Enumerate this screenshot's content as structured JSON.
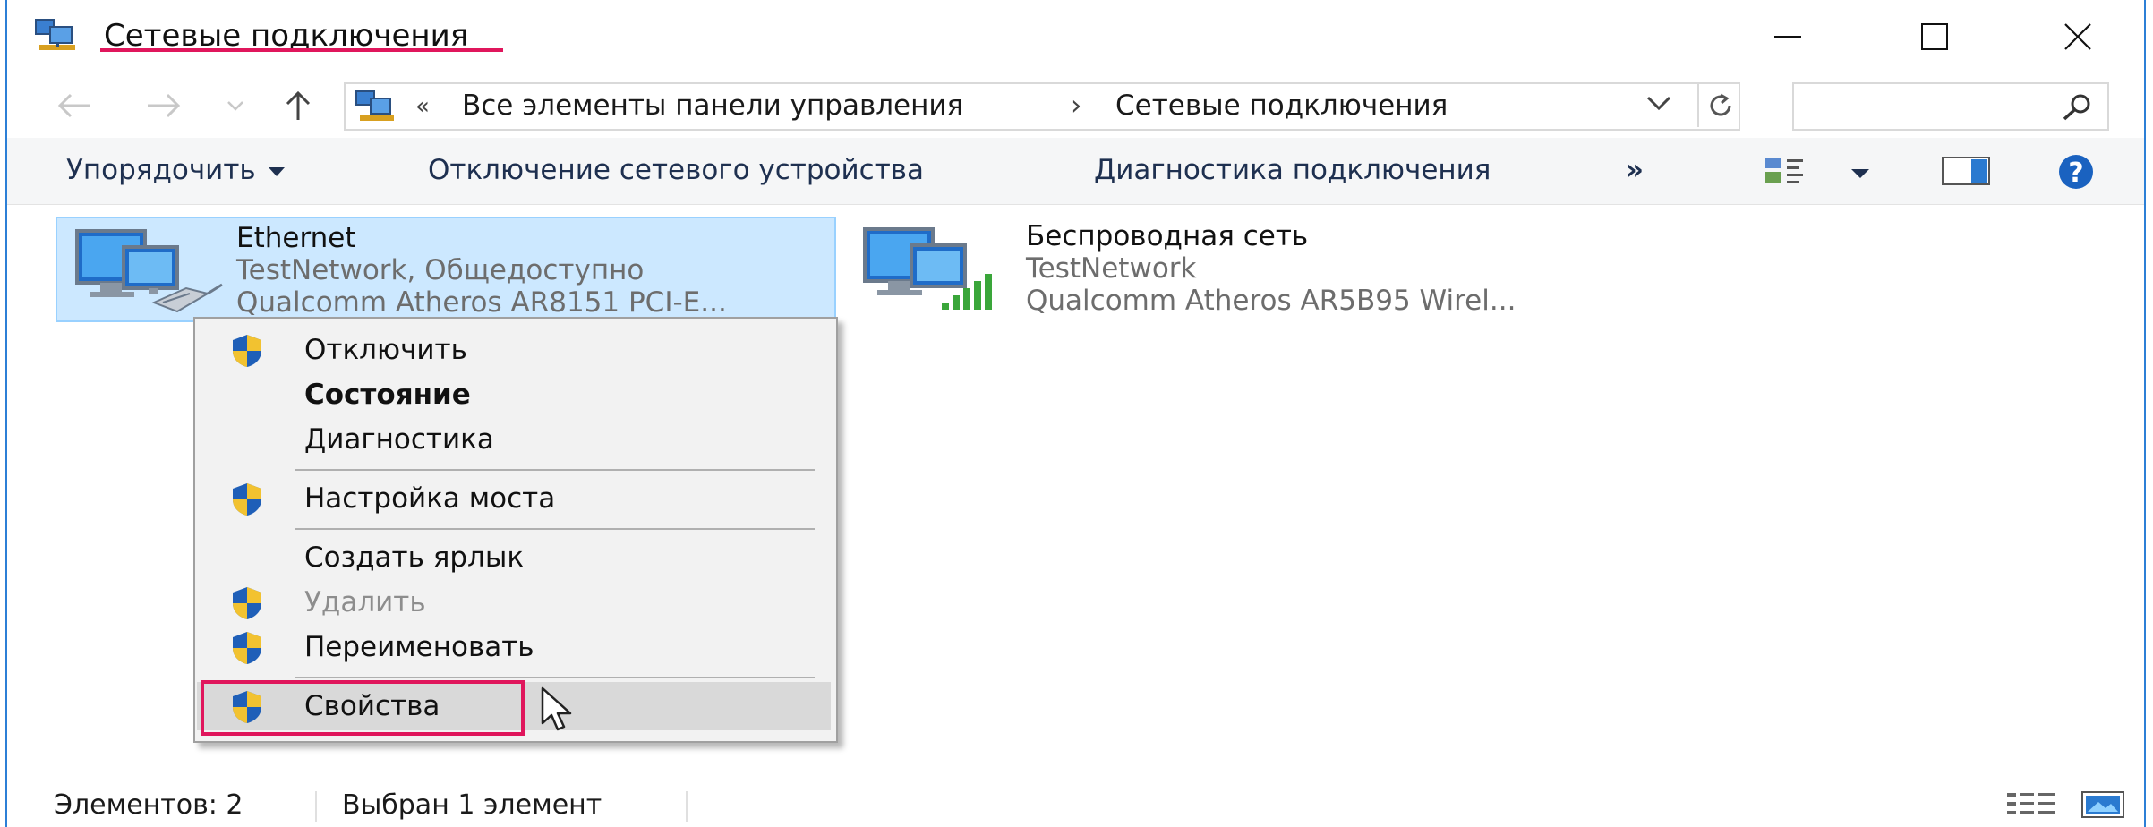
{
  "window": {
    "title": "Сетевые подключения",
    "accent_color": "#2c7fd6",
    "highlight_color": "#e0165c"
  },
  "titlebar_buttons": {
    "minimize_icon": "minimize-icon",
    "maximize_icon": "maximize-icon",
    "close_icon": "close-icon"
  },
  "address": {
    "prefix": "«",
    "crumb_1": "Все элементы панели управления",
    "separator": "›",
    "crumb_2": "Сетевые подключения"
  },
  "search": {
    "placeholder": ""
  },
  "toolbar": {
    "organize": "Упорядочить",
    "disable_device": "Отключение сетевого устройства",
    "diagnose": "Диагностика подключения",
    "more": "»"
  },
  "items": [
    {
      "name": "Ethernet",
      "status": "TestNetwork, Общедоступно",
      "adapter": "Qualcomm Atheros AR8151 PCI-E..."
    },
    {
      "name": "Беспроводная сеть",
      "status": "TestNetwork",
      "adapter": "Qualcomm Atheros AR5B95 Wirel..."
    }
  ],
  "context_menu": {
    "items": [
      {
        "label": "Отключить",
        "shield": true
      },
      {
        "label": "Состояние",
        "bold": true
      },
      {
        "label": "Диагностика"
      },
      {
        "label": "Настройка моста",
        "shield": true
      },
      {
        "label": "Создать ярлык"
      },
      {
        "label": "Удалить",
        "shield": true,
        "disabled": true
      },
      {
        "label": "Переименовать",
        "shield": true
      },
      {
        "label": "Свойства",
        "shield": true,
        "hovered": true
      }
    ]
  },
  "statusbar": {
    "count": "Элементов: 2",
    "selected": "Выбран 1 элемент"
  }
}
